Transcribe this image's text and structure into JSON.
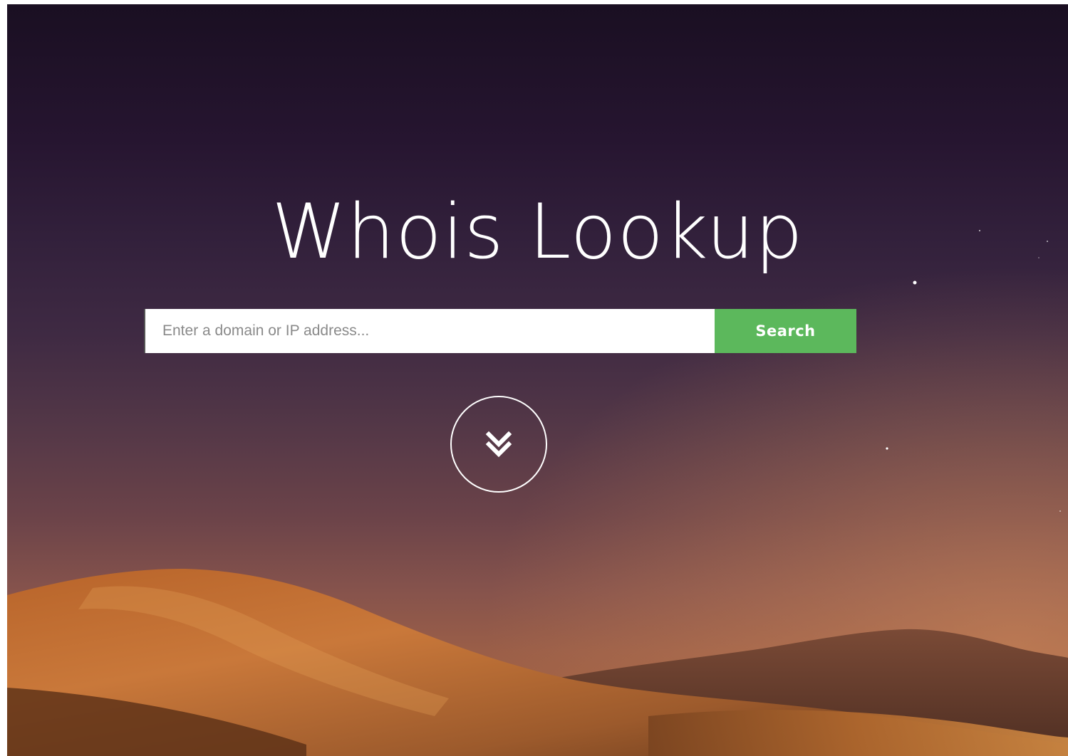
{
  "hero": {
    "title": "Whois Lookup"
  },
  "search": {
    "placeholder": "Enter a domain or IP address...",
    "value": "",
    "button_label": "Search",
    "button_color": "#5cb85c"
  },
  "scroll_button": {
    "icon": "double-chevron-down-icon"
  },
  "background": {
    "scene": "desert-dunes-dusk"
  }
}
